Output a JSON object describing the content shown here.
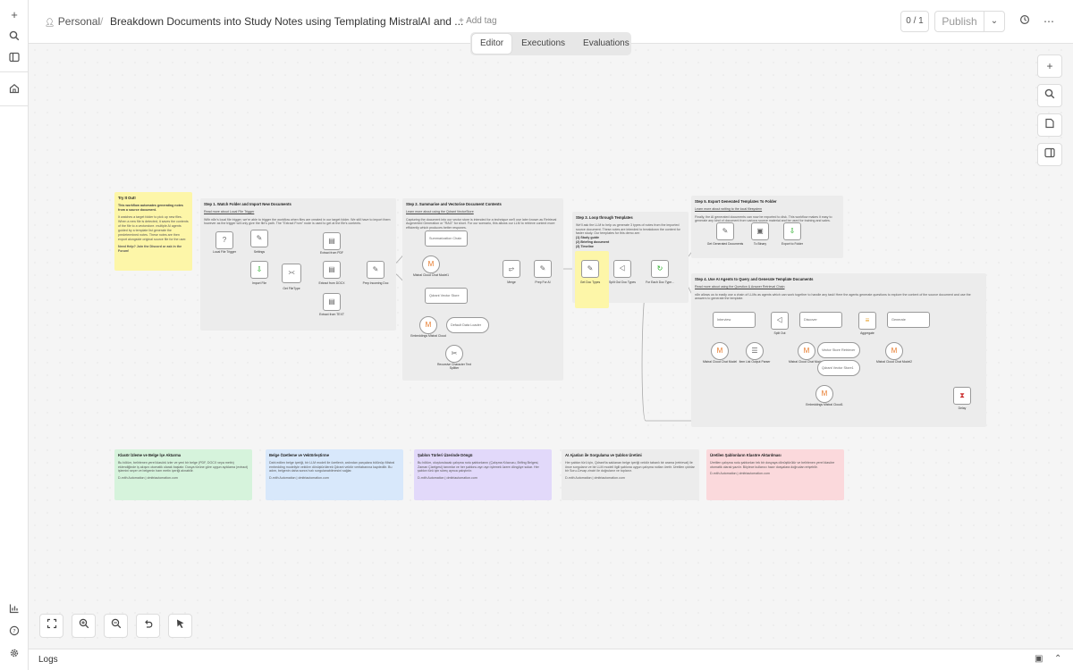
{
  "header": {
    "project_name": "Personal",
    "separator": "/",
    "workflow_title": "Breakdown Documents into Study Notes using Templating MistralAI and ...",
    "add_tag": "+ Add tag",
    "counter": "0 / 1",
    "publish_label": "Publish"
  },
  "tabs": [
    {
      "label": "Editor",
      "active": true
    },
    {
      "label": "Executions",
      "active": false
    },
    {
      "label": "Evaluations",
      "active": false
    }
  ],
  "rail_icons": [
    "plus-icon",
    "search-icon",
    "panel-icon",
    "home-icon",
    "chart-icon",
    "help-icon",
    "settings-icon"
  ],
  "canvas": {
    "notes": {
      "try": {
        "title": "Try It Out!",
        "subtitle": "This workflow automates generating notes from a source document.",
        "body": "It watches a target folder to pick up new files. When a new file is detected, it saves the contents of the file to a vectorstore. multiple AI agents guided by a template list generate the predetermined notes. These notes are then export alongside original source file for the user.",
        "footer": "Need Help? Join the Discord or ask in the Forum!"
      },
      "step1": {
        "title": "Step 1. Watch Folder and Import New Documents",
        "link": "Read more about Local File Trigger",
        "body": "With n8n's local file trigger, we're able to trigger the workflow when files are created in our target folder. We still have to import them however as the trigger will only give the file's path. The \"Extract From\" node is used to get at the file's contents."
      },
      "step2": {
        "title": "Step 2. Summarise and Vectorise Document Contents",
        "link": "Learn more about using the Qdrant VectorStore",
        "body": "Capturing the document into our vector store is intended for a technique we'll use later known as Retrieval Augmented Generation or \"RAG\" for short. For our scenario, this allows our LLM to retrieve context more efficiently which produces better respones."
      },
      "step3": {
        "title": "Step 3. Loop through Templates",
        "body": "We'll ask the LLM to help us generate 3 types of notes from the imported source document. These notes are intended to breakdown the content for faster study. Our templates for this demo are:",
        "list": [
          "(1) Study guide",
          "(2) Briefing document",
          "(3) Timeline"
        ]
      },
      "step5": {
        "title": "Step 5. Export Generated Templates To Folder",
        "link": "Learn more about writing to the local filesystem",
        "body": "Finally, the AI generated documents can now be exported to disk. This workflow makes it easy to generate any kind of document from various source material and be used for training and sales."
      },
      "step4": {
        "title": "Step 4. Use AI Agents to Query and Generate Template Documents",
        "link": "Read more about using the Question & Answer Retrieval Chain",
        "body": "n8n allows us to easily use a chain of LLMs as agents which can work together to handle any task! Here the agents generate questions to explore the content of the source document and use the answers to generate the template."
      },
      "green": {
        "title": "Klasör İzleme ve Belge İçe Aktarma",
        "body": "Bu bölüm, belirlenen yerel klasörü izler ve yeni bir belge (PDF, DOCX veya metin) eklendiğinde iş akışını otomatik olarak başlatır. Dosya türüne göre uygun ayıklama (extract) işlemini seçer ve belgenin ham metin içeriği alınabilir.",
        "credit": "D-mith Automation | dmitriautomation.com"
      },
      "blue": {
        "title": "Belge Özetleme ve Vektörleştirme",
        "body": "Dahi edilen belge içeriği, bir LLM modeli ile özetlenir, ardından parçalara bölünüp Mistral embedding modeliyle vektöre dönüştürülerek Qdrant vektör veritabanına kaydedilir. Bu adım, belgenin daha sonra hızlı sorgulanabilmesini sağlar.",
        "credit": "D-mith Automation | dmitriautomation.com"
      },
      "purple": {
        "title": "Şablon Türleri Üzerinde Döngü",
        "body": "Bu bölüm, oluşturulacak çalışma notu şablonlarını (Çalışma Kılavuzu, Brifing Belgesi, Zaman Çizelgesi) tanımlar ve her şablonu ayrı ayrı işlemek üzere döngüye sokar. Her şablon türü için süreç ayrıca çalıştırılır.",
        "credit": "D-mith Automation | dmitriautomation.com"
      },
      "gray": {
        "title": "AI Ajanları ile Sorgulama ve Şablon Üretimi",
        "body": "Her şablon türü için, Qdrant'ta saklanan belge içeriği vektör tabanlı bir arama (retrieval) ile önce sorgulanır ve bir LLM modeli ilgili şablona uygun çalışma notları üretir. Üretilen çıktılar bir Soru-Cevap zinciri ile doğrulanır ve toplanır.",
        "credit": "D-mith Automation | dmitriautomation.com"
      },
      "red": {
        "title": "Üretilen Şablonların Klasöre Aktarılması",
        "body": "Üretilen çalışma notu şablonları tek bir dosyaya dönüştürülür ve belirlenen yerel klasöre otomatik olarak yazılır. Böylece kullanıcı hazır dosyalara doğrudan erişebilir.",
        "credit": "D-mith Automation | dmitriautomation.com"
      }
    },
    "nodes": {
      "local_trigger": "Local File Trigger",
      "settings": "Settings",
      "import_file": "Import File",
      "get_filetype": "Get FileType",
      "extract_pdf": "Extract from PDF",
      "extract_docx": "Extract from DOCX",
      "extract_text": "Extract from TEXT",
      "prep_doc": "Prep Incoming Doc",
      "summarization": "Summarization Chain",
      "mistral_chat": "Mistral Cloud Chat Model1",
      "qdrant_store": "Qdrant Vector Store",
      "embeddings": "Embeddings Mistral Cloud",
      "data_loader": "Default Data Loader",
      "splitter": "Recursive Character Text Splitter",
      "merge": "Merge",
      "prep_ai": "Prep For AI",
      "get_doc_types": "Get Doc Types",
      "split_doc_types": "Split Out Doc Types",
      "for_each": "For Each Doc Type...",
      "get_generated": "Get Generated Documents",
      "to_binary": "To Binary",
      "export_folder": "Export to Folder",
      "interview": "Interview",
      "split_out": "Split Out",
      "discover": "Discover",
      "aggregate": "Aggregate",
      "generate": "Generate",
      "mistral_chat2": "Mistral Cloud Chat Model",
      "item_list_parser": "Item List Output Parser",
      "mistral_chat3": "Mistral Cloud Chat Model3",
      "vector_retriever": "Vector Store Retriever",
      "qdrant_short": "Qdrant Vector Store1",
      "mistral_chat4": "Mistral Cloud Chat Model2",
      "embeddings2": "Embeddings Mistral Cloud1",
      "delay": "Delay"
    }
  },
  "right_toolbar": [
    "plus-icon",
    "search-icon",
    "sticky-note-icon",
    "sidebar-icon"
  ],
  "bottom_controls": [
    "fit-view-icon",
    "zoom-in-icon",
    "zoom-out-icon",
    "undo-icon",
    "cursor-icon"
  ],
  "logs": {
    "label": "Logs"
  }
}
